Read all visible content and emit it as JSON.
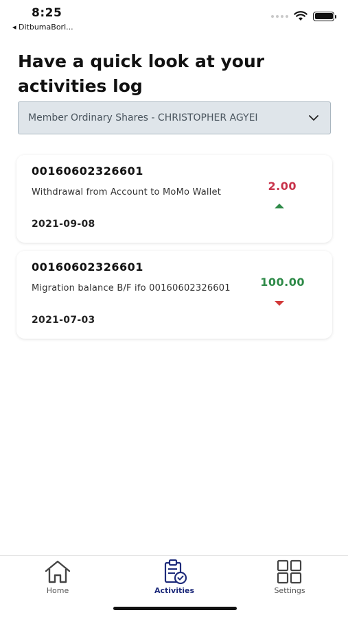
{
  "status_bar": {
    "time": "8:25",
    "back_app": "◂ DitbumaBorl..."
  },
  "page": {
    "title": "Have a quick look at your activities log"
  },
  "account_select": {
    "value": "Member Ordinary Shares - CHRISTOPHER AGYEI"
  },
  "activities": [
    {
      "account": "00160602326601",
      "description": "Withdrawal from Account to MoMo Wallet",
      "date": "2021-09-08",
      "amount": "2.00",
      "amount_color": "#c8324a",
      "trend_icon": "triangle-up-icon"
    },
    {
      "account": "00160602326601",
      "description": "Migration balance B/F ifo 00160602326601",
      "date": "2021-07-03",
      "amount": "100.00",
      "amount_color": "#2e8a48",
      "trend_icon": "triangle-down-icon"
    }
  ],
  "tabs": [
    {
      "label": "Home",
      "icon": "home-icon"
    },
    {
      "label": "Activities",
      "icon": "clipboard-check-icon",
      "active": true
    },
    {
      "label": "Settings",
      "icon": "grid-icon"
    }
  ],
  "colors": {
    "active_tab": "#1d2a7a",
    "dropdown_bg": "#dfe5ea"
  }
}
